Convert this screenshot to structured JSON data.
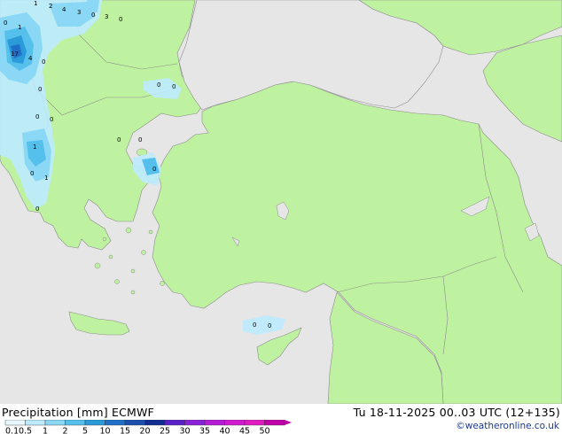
{
  "header": {
    "title": "Precipitation [mm]  ECMWF",
    "datetime": "Tu 18-11-2025 00..03 UTC (12+135)",
    "credit": "©weatheronline.co.uk"
  },
  "legend": {
    "ticks": [
      "0.1",
      "0.5",
      "1",
      "2",
      "5",
      "10",
      "15",
      "20",
      "25",
      "30",
      "35",
      "40",
      "45",
      "50"
    ],
    "colors": [
      "#e8f8ff",
      "#bdeaff",
      "#8ad8f6",
      "#55c0ec",
      "#2a9ad8",
      "#1f6fc8",
      "#1a4fb0",
      "#102c90",
      "#5a20c8",
      "#8a20d8",
      "#b41cd6",
      "#d01cd0",
      "#e01cc0",
      "#c000a8"
    ]
  },
  "map": {
    "sea_color": "#e6e6e6",
    "land_color": "#bff2a0",
    "border_color": "#8c8c8c",
    "precip_values": [
      {
        "label": "1"
      },
      {
        "label": "2"
      },
      {
        "label": "4"
      },
      {
        "label": "3"
      },
      {
        "label": "0"
      },
      {
        "label": "3"
      },
      {
        "label": "0"
      },
      {
        "label": "0"
      },
      {
        "label": "1"
      },
      {
        "label": "17"
      },
      {
        "label": "4"
      },
      {
        "label": "0"
      },
      {
        "label": "0"
      },
      {
        "label": "0"
      },
      {
        "label": "0"
      },
      {
        "label": "0"
      },
      {
        "label": "0"
      },
      {
        "label": "1"
      },
      {
        "label": "0"
      },
      {
        "label": "0"
      },
      {
        "label": "1"
      },
      {
        "label": "0"
      },
      {
        "label": "0"
      },
      {
        "label": "0"
      },
      {
        "label": "0"
      },
      {
        "label": "0"
      }
    ]
  }
}
